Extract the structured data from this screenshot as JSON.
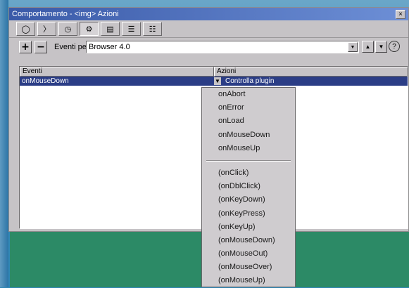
{
  "window": {
    "title": "Comportamento - <img> Azioni",
    "close": "×"
  },
  "toolbar": {
    "tabs": [
      {
        "name": "circles-icon",
        "glyph": "◯"
      },
      {
        "name": "arrow-right-icon",
        "glyph": "〉"
      },
      {
        "name": "clock-icon",
        "glyph": "◷"
      },
      {
        "name": "gear-icon",
        "glyph": "⚙"
      },
      {
        "name": "window-icon",
        "glyph": "▤"
      },
      {
        "name": "list-icon",
        "glyph": "☰"
      },
      {
        "name": "grid-icon",
        "glyph": "☷"
      }
    ],
    "active_tab": 3
  },
  "events_bar": {
    "add_label": "+",
    "remove_label": "−",
    "events_for_label": "Eventi per:",
    "browser_value": "Browser 4.0",
    "dropdown_arrow": "▼",
    "up_arrow": "▲",
    "down_arrow": "▼",
    "help": "?"
  },
  "table": {
    "headers": {
      "events": "Eventi",
      "actions": "Azioni"
    },
    "selected_row": {
      "event": "onMouseDown",
      "action": "Controlla plugin",
      "arrow": "▼"
    }
  },
  "dropdown": {
    "group1": [
      "onAbort",
      "onError",
      "onLoad",
      "onMouseDown",
      "onMouseUp"
    ],
    "group2": [
      "(onClick)",
      "(onDblClick)",
      "(onKeyDown)",
      "(onKeyPress)",
      "(onKeyUp)",
      "(onMouseDown)",
      "(onMouseOut)",
      "(onMouseOver)",
      "(onMouseUp)"
    ]
  }
}
